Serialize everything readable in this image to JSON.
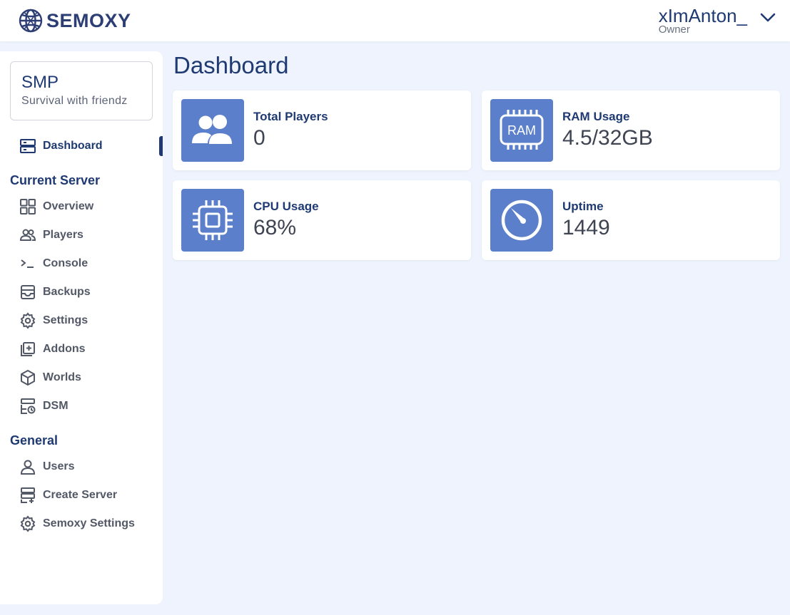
{
  "brand": {
    "name": "SEMOXY"
  },
  "user": {
    "name": "xImAnton_",
    "role": "Owner"
  },
  "server": {
    "name": "SMP",
    "description": "Survival with friendz"
  },
  "nav": {
    "dashboard": "Dashboard",
    "current_server_title": "Current Server",
    "current_server_items": [
      {
        "label": "Overview",
        "icon": "grid-icon"
      },
      {
        "label": "Players",
        "icon": "users-icon"
      },
      {
        "label": "Console",
        "icon": "terminal-icon"
      },
      {
        "label": "Backups",
        "icon": "archive-icon"
      },
      {
        "label": "Settings",
        "icon": "gear-icon"
      },
      {
        "label": "Addons",
        "icon": "add-box-icon"
      },
      {
        "label": "Worlds",
        "icon": "cube-icon"
      },
      {
        "label": "DSM",
        "icon": "server-sync-icon"
      }
    ],
    "general_title": "General",
    "general_items": [
      {
        "label": "Users",
        "icon": "user-icon"
      },
      {
        "label": "Create Server",
        "icon": "server-add-icon"
      },
      {
        "label": "Semoxy Settings",
        "icon": "gear-icon"
      }
    ]
  },
  "page": {
    "title": "Dashboard"
  },
  "stats": [
    {
      "label": "Total Players",
      "value": "0",
      "icon": "users-icon"
    },
    {
      "label": "RAM Usage",
      "value": "4.5/32GB",
      "icon": "ram-icon",
      "icon_text": "RAM"
    },
    {
      "label": "CPU Usage",
      "value": "68%",
      "icon": "cpu-icon"
    },
    {
      "label": "Uptime",
      "value": "1449",
      "icon": "gauge-icon"
    }
  ],
  "colors": {
    "accent": "#1f3a73",
    "tile": "#5b7fcb",
    "background": "#eef3fd",
    "nav_text": "#525866"
  }
}
